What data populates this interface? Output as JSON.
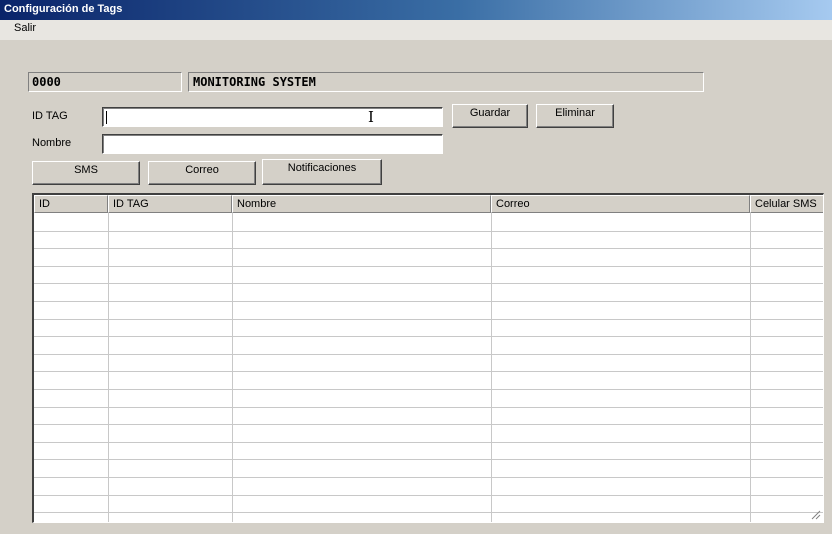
{
  "window": {
    "title": "Configuración de Tags"
  },
  "menu": {
    "items": [
      "Salir"
    ]
  },
  "status": {
    "code": "0000",
    "system_name": "MONITORING SYSTEM"
  },
  "form": {
    "id_tag_label": "ID TAG",
    "id_tag_value": "",
    "nombre_label": "Nombre",
    "nombre_value": ""
  },
  "buttons": {
    "guardar": "Guardar",
    "eliminar": "Eliminar",
    "sms": "SMS",
    "correo": "Correo",
    "notificaciones": "Notificaciones"
  },
  "table": {
    "columns": [
      "ID",
      "ID TAG",
      "Nombre",
      "Correo",
      "Celular SMS"
    ],
    "rows": []
  }
}
